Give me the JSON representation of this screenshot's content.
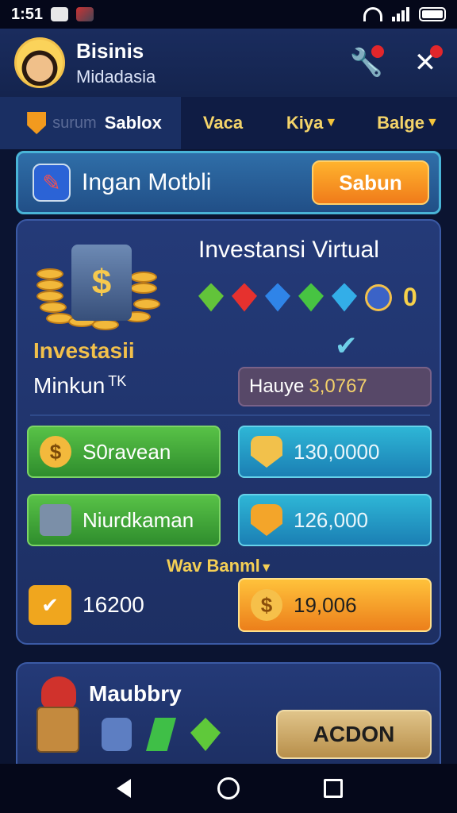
{
  "status_bar": {
    "time": "1:51"
  },
  "header": {
    "name": "Bisinis",
    "subtitle": "Midadasia",
    "actions": [
      {
        "icon": "wrench-icon"
      },
      {
        "icon": "tools-icon"
      }
    ]
  },
  "tabs": [
    {
      "hint": "surum",
      "label": "Sablox",
      "active": true
    },
    {
      "label": "Vaca"
    },
    {
      "label": "Kiya",
      "caret": "▼"
    },
    {
      "label": "Balge",
      "caret": "▼"
    }
  ],
  "banner": {
    "title": "Ingan Motbli",
    "button": "Sabun"
  },
  "invest": {
    "title": "Investasii",
    "subtitle": "Minkun",
    "subtitle_mark": "TK",
    "virtual_title": "Investansi Virtual",
    "gem_count": "0",
    "value_label": "Hauye",
    "value_amount": "3,0767"
  },
  "stats": {
    "green1": "S0ravean",
    "cyan1": "130,0000",
    "green2": "Niurdkaman",
    "cyan2": "126,000",
    "bonus_label": "Wav Banml",
    "bonus_caret": "▼",
    "left_value": "16200",
    "gold_value": "19,006"
  },
  "panel2": {
    "title": "Maubbry",
    "button": "ACDON"
  }
}
